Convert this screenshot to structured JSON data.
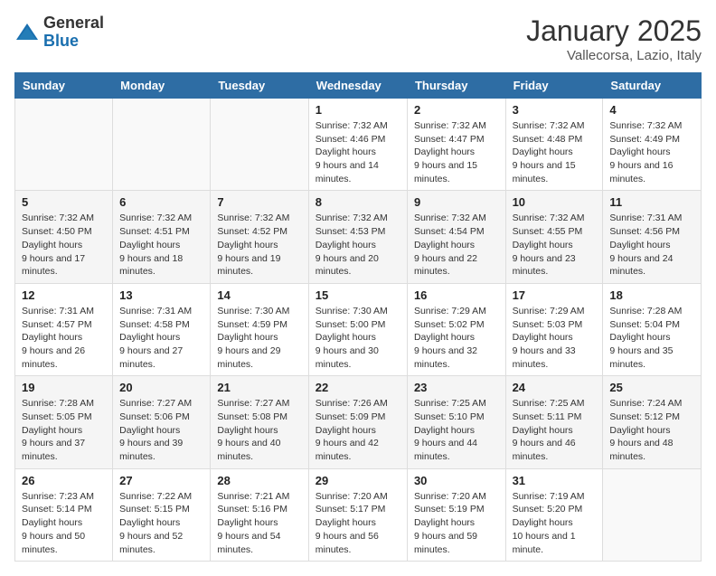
{
  "logo": {
    "general": "General",
    "blue": "Blue"
  },
  "title": "January 2025",
  "location": "Vallecorsa, Lazio, Italy",
  "days_of_week": [
    "Sunday",
    "Monday",
    "Tuesday",
    "Wednesday",
    "Thursday",
    "Friday",
    "Saturday"
  ],
  "weeks": [
    [
      {
        "day": "",
        "info": ""
      },
      {
        "day": "",
        "info": ""
      },
      {
        "day": "",
        "info": ""
      },
      {
        "day": "1",
        "sunrise": "7:32 AM",
        "sunset": "4:46 PM",
        "daylight": "9 hours and 14 minutes."
      },
      {
        "day": "2",
        "sunrise": "7:32 AM",
        "sunset": "4:47 PM",
        "daylight": "9 hours and 15 minutes."
      },
      {
        "day": "3",
        "sunrise": "7:32 AM",
        "sunset": "4:48 PM",
        "daylight": "9 hours and 15 minutes."
      },
      {
        "day": "4",
        "sunrise": "7:32 AM",
        "sunset": "4:49 PM",
        "daylight": "9 hours and 16 minutes."
      }
    ],
    [
      {
        "day": "5",
        "sunrise": "7:32 AM",
        "sunset": "4:50 PM",
        "daylight": "9 hours and 17 minutes."
      },
      {
        "day": "6",
        "sunrise": "7:32 AM",
        "sunset": "4:51 PM",
        "daylight": "9 hours and 18 minutes."
      },
      {
        "day": "7",
        "sunrise": "7:32 AM",
        "sunset": "4:52 PM",
        "daylight": "9 hours and 19 minutes."
      },
      {
        "day": "8",
        "sunrise": "7:32 AM",
        "sunset": "4:53 PM",
        "daylight": "9 hours and 20 minutes."
      },
      {
        "day": "9",
        "sunrise": "7:32 AM",
        "sunset": "4:54 PM",
        "daylight": "9 hours and 22 minutes."
      },
      {
        "day": "10",
        "sunrise": "7:32 AM",
        "sunset": "4:55 PM",
        "daylight": "9 hours and 23 minutes."
      },
      {
        "day": "11",
        "sunrise": "7:31 AM",
        "sunset": "4:56 PM",
        "daylight": "9 hours and 24 minutes."
      }
    ],
    [
      {
        "day": "12",
        "sunrise": "7:31 AM",
        "sunset": "4:57 PM",
        "daylight": "9 hours and 26 minutes."
      },
      {
        "day": "13",
        "sunrise": "7:31 AM",
        "sunset": "4:58 PM",
        "daylight": "9 hours and 27 minutes."
      },
      {
        "day": "14",
        "sunrise": "7:30 AM",
        "sunset": "4:59 PM",
        "daylight": "9 hours and 29 minutes."
      },
      {
        "day": "15",
        "sunrise": "7:30 AM",
        "sunset": "5:00 PM",
        "daylight": "9 hours and 30 minutes."
      },
      {
        "day": "16",
        "sunrise": "7:29 AM",
        "sunset": "5:02 PM",
        "daylight": "9 hours and 32 minutes."
      },
      {
        "day": "17",
        "sunrise": "7:29 AM",
        "sunset": "5:03 PM",
        "daylight": "9 hours and 33 minutes."
      },
      {
        "day": "18",
        "sunrise": "7:28 AM",
        "sunset": "5:04 PM",
        "daylight": "9 hours and 35 minutes."
      }
    ],
    [
      {
        "day": "19",
        "sunrise": "7:28 AM",
        "sunset": "5:05 PM",
        "daylight": "9 hours and 37 minutes."
      },
      {
        "day": "20",
        "sunrise": "7:27 AM",
        "sunset": "5:06 PM",
        "daylight": "9 hours and 39 minutes."
      },
      {
        "day": "21",
        "sunrise": "7:27 AM",
        "sunset": "5:08 PM",
        "daylight": "9 hours and 40 minutes."
      },
      {
        "day": "22",
        "sunrise": "7:26 AM",
        "sunset": "5:09 PM",
        "daylight": "9 hours and 42 minutes."
      },
      {
        "day": "23",
        "sunrise": "7:25 AM",
        "sunset": "5:10 PM",
        "daylight": "9 hours and 44 minutes."
      },
      {
        "day": "24",
        "sunrise": "7:25 AM",
        "sunset": "5:11 PM",
        "daylight": "9 hours and 46 minutes."
      },
      {
        "day": "25",
        "sunrise": "7:24 AM",
        "sunset": "5:12 PM",
        "daylight": "9 hours and 48 minutes."
      }
    ],
    [
      {
        "day": "26",
        "sunrise": "7:23 AM",
        "sunset": "5:14 PM",
        "daylight": "9 hours and 50 minutes."
      },
      {
        "day": "27",
        "sunrise": "7:22 AM",
        "sunset": "5:15 PM",
        "daylight": "9 hours and 52 minutes."
      },
      {
        "day": "28",
        "sunrise": "7:21 AM",
        "sunset": "5:16 PM",
        "daylight": "9 hours and 54 minutes."
      },
      {
        "day": "29",
        "sunrise": "7:20 AM",
        "sunset": "5:17 PM",
        "daylight": "9 hours and 56 minutes."
      },
      {
        "day": "30",
        "sunrise": "7:20 AM",
        "sunset": "5:19 PM",
        "daylight": "9 hours and 59 minutes."
      },
      {
        "day": "31",
        "sunrise": "7:19 AM",
        "sunset": "5:20 PM",
        "daylight": "10 hours and 1 minute."
      },
      {
        "day": "",
        "info": ""
      }
    ]
  ],
  "labels": {
    "sunrise": "Sunrise:",
    "sunset": "Sunset:",
    "daylight": "Daylight hours"
  }
}
